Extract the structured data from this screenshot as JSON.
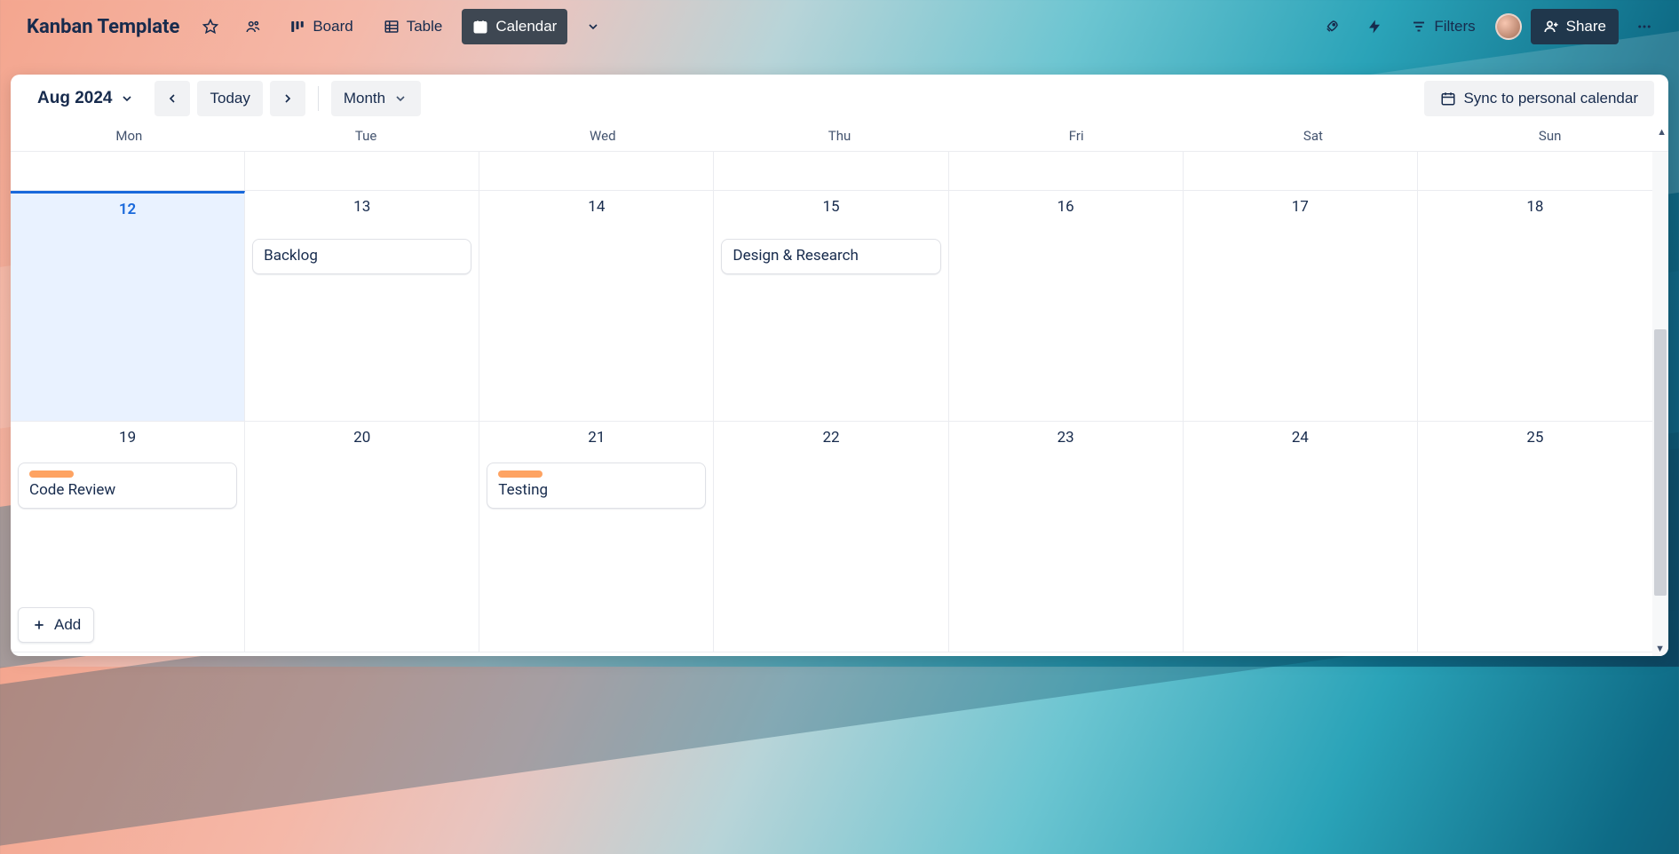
{
  "header": {
    "title": "Kanban Template",
    "views": {
      "board": "Board",
      "table": "Table",
      "calendar": "Calendar"
    },
    "filters": "Filters",
    "share": "Share"
  },
  "toolbar": {
    "month_label": "Aug 2024",
    "today": "Today",
    "range": "Month",
    "sync": "Sync to personal calendar"
  },
  "day_headers": [
    "Mon",
    "Tue",
    "Wed",
    "Thu",
    "Fri",
    "Sat",
    "Sun"
  ],
  "weeks": [
    {
      "days": [
        {
          "num": "12",
          "today": true,
          "cards": []
        },
        {
          "num": "13",
          "cards": [
            {
              "title": "Backlog"
            }
          ]
        },
        {
          "num": "14",
          "cards": []
        },
        {
          "num": "15",
          "cards": [
            {
              "title": "Design & Research"
            }
          ]
        },
        {
          "num": "16",
          "cards": []
        },
        {
          "num": "17",
          "cards": []
        },
        {
          "num": "18",
          "cards": []
        }
      ]
    },
    {
      "days": [
        {
          "num": "19",
          "cards": [
            {
              "title": "Code Review",
              "label": "orange"
            }
          ],
          "add": true
        },
        {
          "num": "20",
          "cards": []
        },
        {
          "num": "21",
          "cards": [
            {
              "title": "Testing",
              "label": "orange"
            }
          ]
        },
        {
          "num": "22",
          "cards": []
        },
        {
          "num": "23",
          "cards": []
        },
        {
          "num": "24",
          "cards": []
        },
        {
          "num": "25",
          "cards": []
        }
      ]
    }
  ],
  "add_label": "Add"
}
